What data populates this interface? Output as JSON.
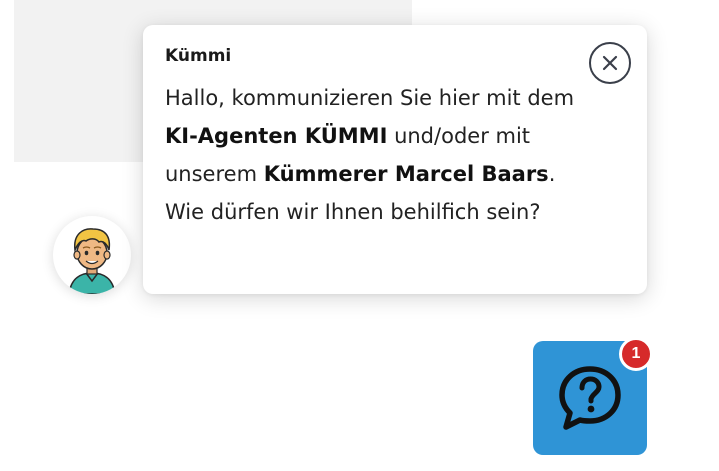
{
  "background_color": "#f2f2f2",
  "chat_popup": {
    "agent_name": "Kümmi",
    "message_segments": [
      {
        "text": "Hallo, kommunizieren Sie hier mit dem ",
        "bold": false
      },
      {
        "text": "KI-Agenten KÜMMI",
        "bold": true
      },
      {
        "text": " und/oder mit unserem ",
        "bold": false
      },
      {
        "text": "Kümmerer Marcel Baars",
        "bold": true
      },
      {
        "text": ". Wie dürfen wir Ihnen behilfich sein?",
        "bold": false
      }
    ],
    "close_icon": "close-circle-icon"
  },
  "avatar": {
    "icon": "agent-avatar-icon"
  },
  "help_button": {
    "icon": "question-speech-bubble-icon",
    "color": "#2f94d6",
    "badge_count": "1",
    "badge_color": "#d62a2a"
  }
}
